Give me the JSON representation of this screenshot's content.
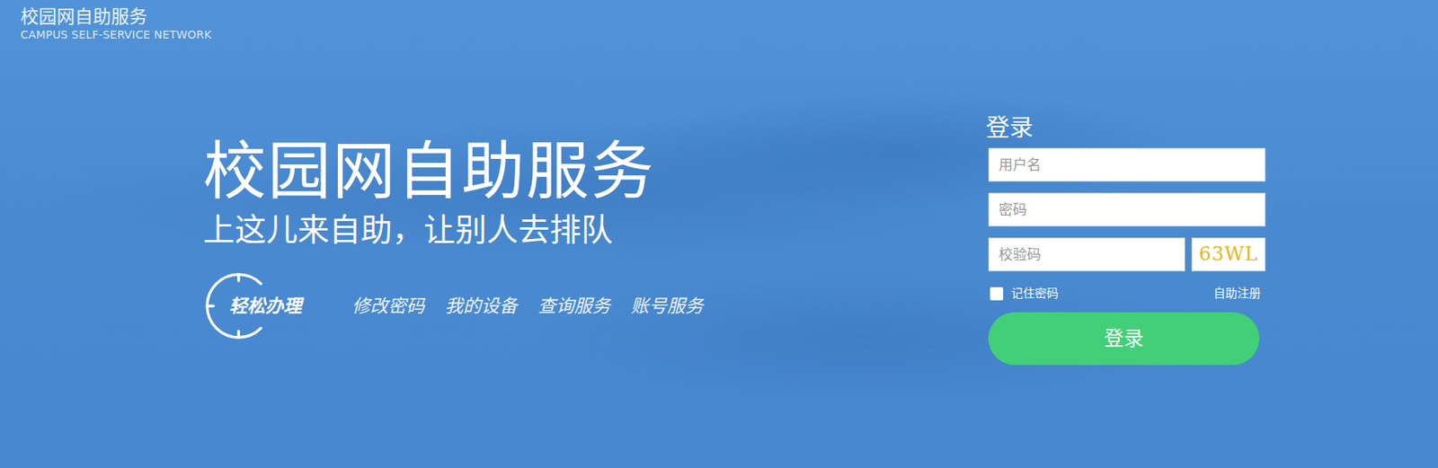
{
  "header": {
    "title": "校园网自助服务",
    "subtitle": "CAMPUS  SELF-SERVICE NETWORK"
  },
  "hero": {
    "title": "校园网自助服务",
    "slogan": "上这儿来自助，让别人去排队",
    "badge": "轻松办理",
    "links": [
      "修改密码",
      "我的设备",
      "查询服务",
      "账号服务"
    ]
  },
  "login": {
    "title": "登录",
    "username": {
      "placeholder": "用户名"
    },
    "password": {
      "placeholder": "密码"
    },
    "captcha": {
      "placeholder": "校验码",
      "code": "63WL"
    },
    "remember": {
      "label": "记住密码",
      "checked": false
    },
    "register": "自助注册",
    "submit": "登录"
  }
}
